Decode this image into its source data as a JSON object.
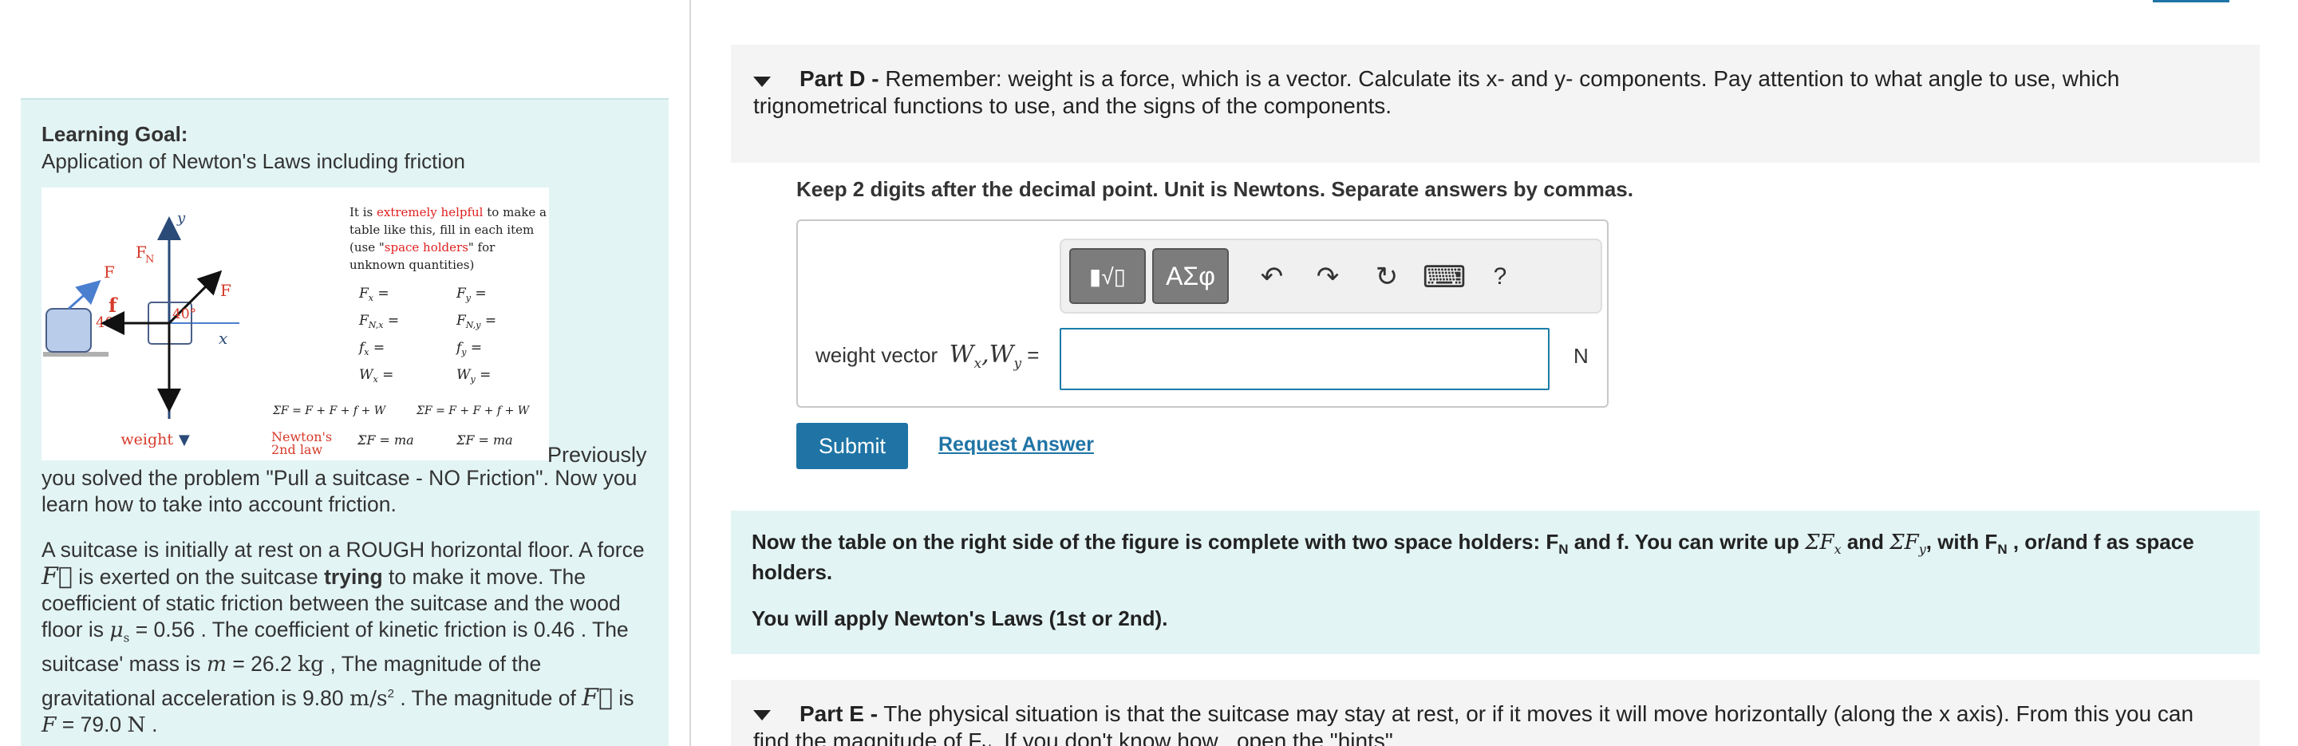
{
  "learning_goal": {
    "title": "Learning Goal:",
    "subtitle": "Application of Newton's Laws including friction",
    "figure": {
      "labels": {
        "y_axis": "y",
        "x_axis": "x",
        "force_left": "F",
        "f_left": "f",
        "angle_left": "40°",
        "fn": "F",
        "fn_sub": "N",
        "angle_center": "40°",
        "f_center": "F",
        "weight": "weight",
        "newtons_law_1": "Newton's",
        "newtons_law_2": "2nd law"
      },
      "note_parts": [
        "It is ",
        "extremely helpful",
        " to make a",
        "table like this, fill in each item",
        "(use \"",
        "space holders",
        "\" for",
        "unknown quantities)"
      ],
      "table_left": [
        "F",
        "F",
        "f",
        "W"
      ],
      "table_left_sub": [
        "x",
        "N,x",
        "x",
        "x"
      ],
      "table_right": [
        "F",
        "F",
        "f",
        "W"
      ],
      "table_right_sub": [
        "y",
        "N,y",
        "y",
        "y"
      ],
      "sum_x": "ΣF = F + F + f + W",
      "sum_y": "ΣF = F + F + f + W",
      "law_x": "ΣF = ma",
      "law_y": "ΣF = ma"
    },
    "previously_inline": "Previously",
    "previously_rest": "you solved the problem \"Pull a suitcase - NO Friction\". Now you learn how to take into account friction.",
    "problem": {
      "l1": "A suitcase is initially at rest on a ROUGH horizontal floor. A force",
      "l2_a": " is exerted on the suitcase ",
      "l2_bold": "trying",
      "l2_b": " to make it move. The",
      "l3": "coefficient of static friction between the suitcase and the wood",
      "l4_a": "floor is ",
      "mu_s_val": " = 0.56 . The coefficient of kinetic friction is 0.46 . The",
      "l5_a": "suitcase' mass is ",
      "mass_val": " = 26.2 ",
      "kg": "kg",
      "l5_b": " , The magnitude of the",
      "l6_a": "gravitational acceleration is 9.80 ",
      "accel_unit": "m/s",
      "l6_b": " . The magnitude of ",
      "l6_c": " is",
      "l7_val": " = 79.0 ",
      "newton": "N",
      "l7_end": " ."
    }
  },
  "part_d": {
    "label": "Part D -",
    "text_line1": " Remember: weight is a force, which is a vector.  Calculate its x- and y- components. Pay attention to what angle to use, which",
    "text_line2": "trignometrical functions to use, and the signs of the components.",
    "instruction": "Keep 2 digits after the decimal point. Unit is Newtons. Separate answers by commas.",
    "toolbar": {
      "templates_icon": "▮√▯",
      "symbols_label": "ΑΣφ",
      "undo_icon": "↶",
      "redo_icon": "↷",
      "reset_icon": "↻",
      "keyboard_icon": "⌨",
      "help_label": "?"
    },
    "input_label": "weight vector",
    "input_value": "",
    "unit": "N",
    "submit_label": "Submit",
    "request_label": "Request Answer"
  },
  "hint": {
    "p1_a": "Now the table on the right side of the figure is complete with two space holders: F",
    "p1_sub": "N",
    "p1_b": " and f. You can write up ",
    "p1_c": " and ",
    "p1_d": ", with F",
    "p1_e": " , or/and f as space",
    "p1_line2": "holders.",
    "p2": "You will apply Newton's Laws (1st or 2nd)."
  },
  "part_e": {
    "label": "Part E -",
    "text_line1": " The physical situation is that the suitcase may stay at rest, or if it moves it will move horizontally (along the x axis). From this you can",
    "text_line2": "find the magnitude of F",
    "text_line2_sub": "N",
    "text_line2_b": ". If you don't know how , open the \"hints\"."
  },
  "colors": {
    "accent": "#1f74a5",
    "goal_bg": "#e3f4f4",
    "header_bg": "#f4f4f4",
    "red_text": "#e02020"
  }
}
